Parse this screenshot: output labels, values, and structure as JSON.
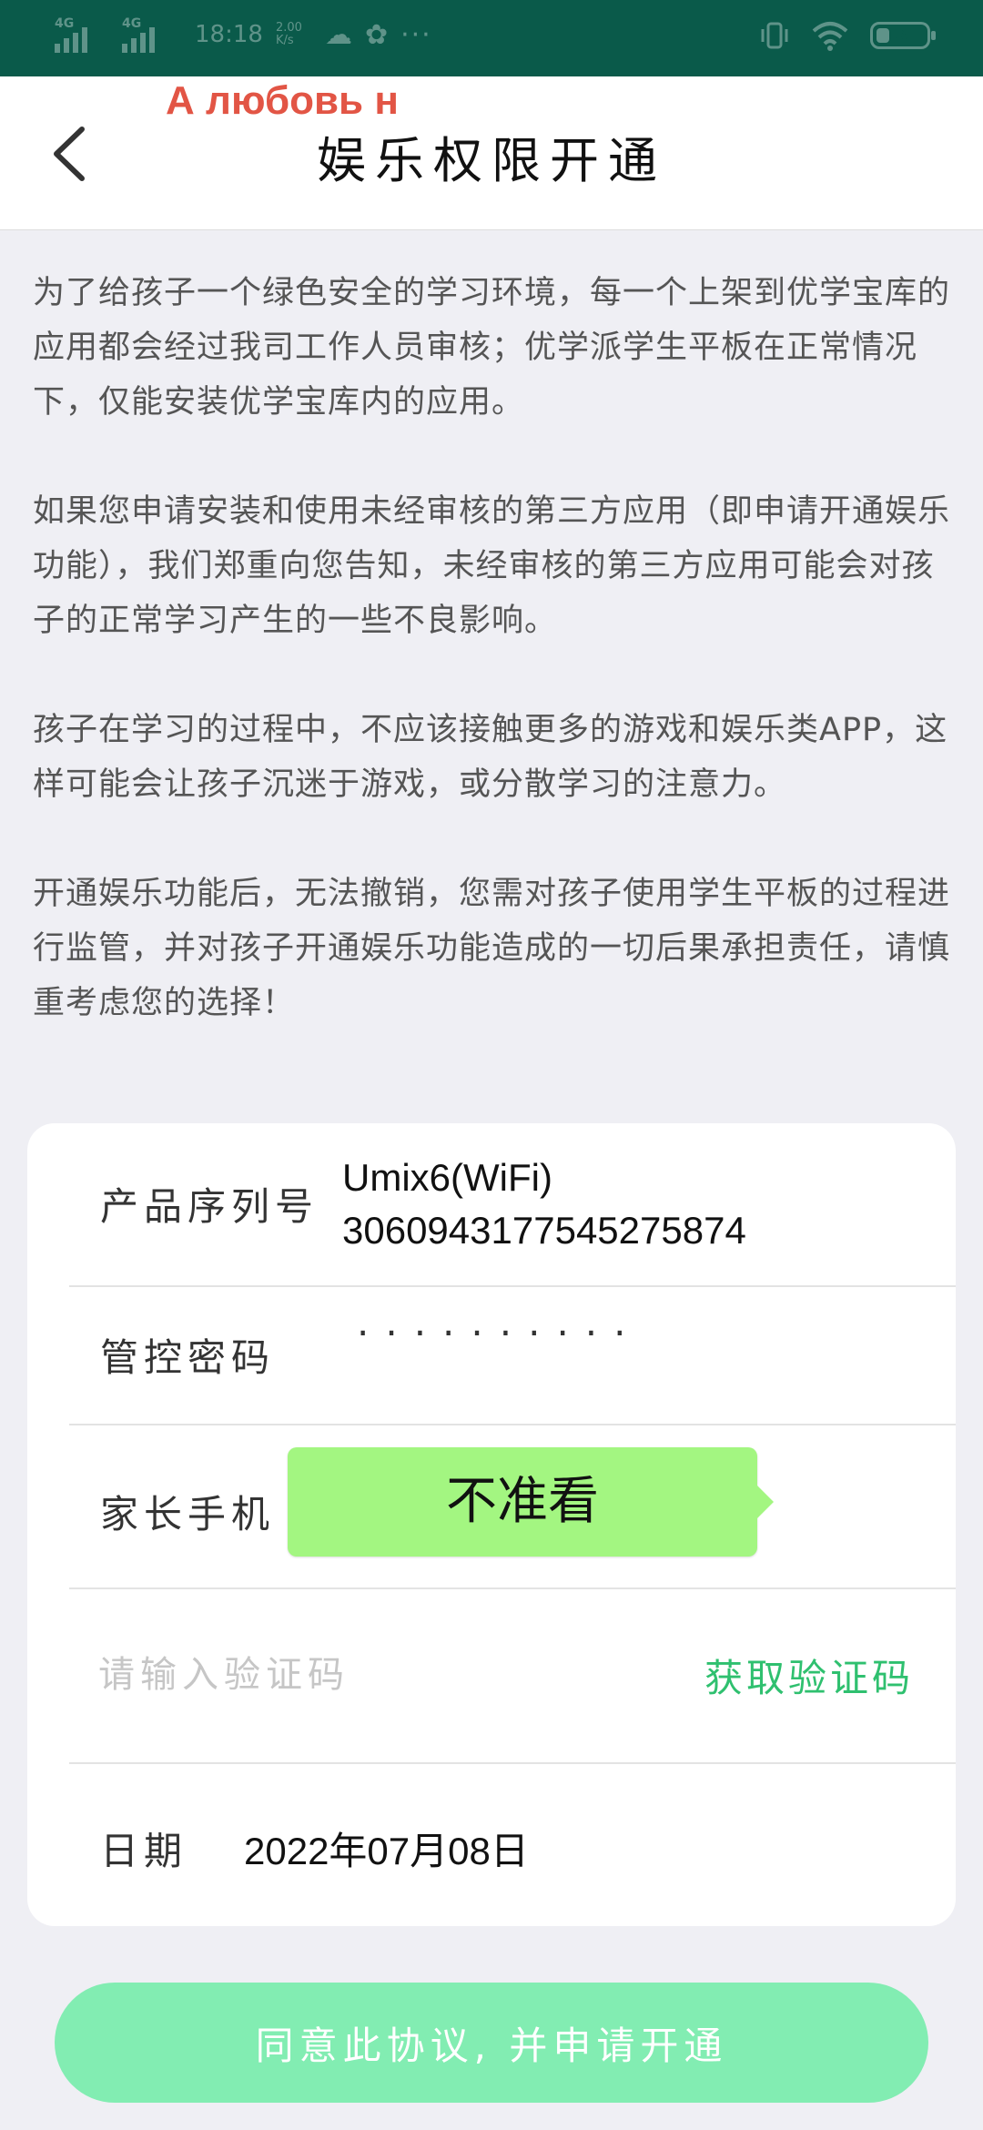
{
  "status_bar": {
    "network_1": "4G",
    "network_2": "4G",
    "time": "18:18",
    "speed_value": "2.00",
    "speed_unit": "K/s",
    "battery": "16"
  },
  "header": {
    "title": "娱乐权限开通",
    "overlay_text": "А любовь н"
  },
  "notice": {
    "paragraphs": [
      "为了给孩子一个绿色安全的学习环境，每一个上架到优学宝库的应用都会经过我司工作人员审核；优学派学生平板在正常情况下，仅能安装优学宝库内的应用。",
      "如果您申请安装和使用未经审核的第三方应用（即申请开通娱乐功能），我们郑重向您告知，未经审核的第三方应用可能会对孩子的正常学习产生的一些不良影响。",
      "孩子在学习的过程中，不应该接触更多的游戏和娱乐类APP，这样可能会让孩子沉迷于游戏，或分散学习的注意力。",
      "开通娱乐功能后，无法撤销，您需对孩子使用学生平板的过程进行监管，并对孩子开通娱乐功能造成的一切后果承担责任，请慎重考虑您的选择！"
    ]
  },
  "form": {
    "serial_label": "产品序列号",
    "serial_model": "Umix6(WiFi)",
    "serial_number": "3060943177545275874",
    "password_label": "管控密码",
    "password_mask": "··········",
    "phone_label": "家长手机",
    "code_placeholder": "请输入验证码",
    "get_code_label": "获取验证码",
    "date_label": "日期",
    "date_value": "2022年07月08日"
  },
  "tooltip": {
    "text": "不准看"
  },
  "submit_label": "同意此协议, 并申请开通",
  "colors": {
    "status_bar": "#0a5a4a",
    "accent_green": "#2fc06f",
    "button_green": "#82edb2",
    "tooltip_green": "#a3f681",
    "overlay_red": "#e25545"
  }
}
